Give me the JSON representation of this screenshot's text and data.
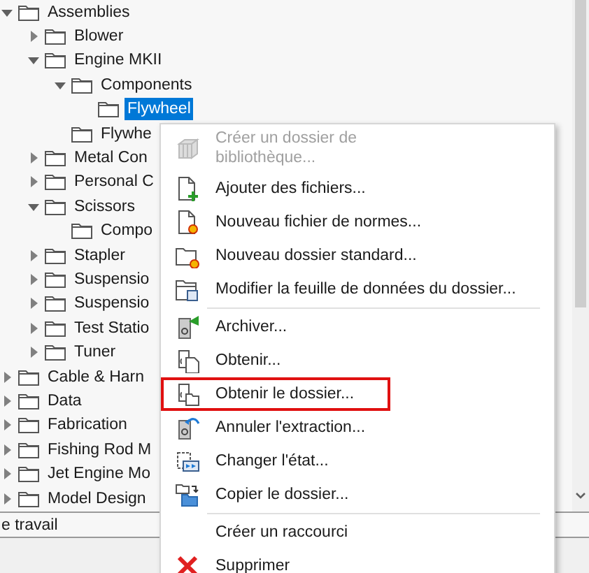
{
  "tree": {
    "items": [
      {
        "label": "Assemblies",
        "expandable": true,
        "expanded": true,
        "selected": false,
        "children": [
          {
            "label": "Blower",
            "expandable": true,
            "expanded": false,
            "selected": false
          },
          {
            "label": "Engine MKII",
            "expandable": true,
            "expanded": true,
            "selected": false,
            "children": [
              {
                "label": "Components",
                "expandable": true,
                "expanded": true,
                "selected": false,
                "children": [
                  {
                    "label": "Flywheel",
                    "expandable": false,
                    "selected": true
                  }
                ]
              },
              {
                "label": "Flywhe",
                "expandable": false,
                "selected": false
              }
            ]
          },
          {
            "label": "Metal Con",
            "expandable": true,
            "expanded": false,
            "selected": false
          },
          {
            "label": "Personal C",
            "expandable": true,
            "expanded": false,
            "selected": false
          },
          {
            "label": "Scissors",
            "expandable": true,
            "expanded": true,
            "selected": false,
            "children": [
              {
                "label": "Compo",
                "expandable": false,
                "selected": false
              }
            ]
          },
          {
            "label": "Stapler",
            "expandable": true,
            "expanded": false,
            "selected": false
          },
          {
            "label": "Suspensio",
            "expandable": true,
            "expanded": false,
            "selected": false
          },
          {
            "label": "Suspensio",
            "expandable": true,
            "expanded": false,
            "selected": false
          },
          {
            "label": "Test Statio",
            "expandable": true,
            "expanded": false,
            "selected": false
          },
          {
            "label": "Tuner",
            "expandable": true,
            "expanded": false,
            "selected": false
          }
        ]
      },
      {
        "label": "Cable & Harn",
        "expandable": true,
        "expanded": false,
        "selected": false
      },
      {
        "label": "Data",
        "expandable": true,
        "expanded": false,
        "selected": false
      },
      {
        "label": "Fabrication",
        "expandable": true,
        "expanded": false,
        "selected": false
      },
      {
        "label": "Fishing Rod M",
        "expandable": true,
        "expanded": false,
        "selected": false
      },
      {
        "label": "Jet Engine Mo",
        "expandable": true,
        "expanded": false,
        "selected": false
      },
      {
        "label": "Model Design",
        "expandable": true,
        "expanded": false,
        "selected": false
      }
    ]
  },
  "status_text": "e travail",
  "context_menu": {
    "items": [
      {
        "kind": "item",
        "label": "Créer un dossier de bibliothèque...",
        "disabled": true,
        "highlighted": false
      },
      {
        "kind": "item",
        "label": "Ajouter des fichiers...",
        "disabled": false,
        "highlighted": false
      },
      {
        "kind": "item",
        "label": "Nouveau fichier de normes...",
        "disabled": false,
        "highlighted": false
      },
      {
        "kind": "item",
        "label": "Nouveau dossier standard...",
        "disabled": false,
        "highlighted": false
      },
      {
        "kind": "item",
        "label": "Modifier la feuille de données du dossier...",
        "disabled": false,
        "highlighted": false
      },
      {
        "kind": "separator"
      },
      {
        "kind": "item",
        "label": "Archiver...",
        "disabled": false,
        "highlighted": false
      },
      {
        "kind": "item",
        "label": "Obtenir...",
        "disabled": false,
        "highlighted": false
      },
      {
        "kind": "item",
        "label": "Obtenir le dossier...",
        "disabled": false,
        "highlighted": true
      },
      {
        "kind": "item",
        "label": "Annuler l'extraction...",
        "disabled": false,
        "highlighted": false
      },
      {
        "kind": "item",
        "label": "Changer l'état...",
        "disabled": false,
        "highlighted": false
      },
      {
        "kind": "item",
        "label": "Copier le dossier...",
        "disabled": false,
        "highlighted": false
      },
      {
        "kind": "separator"
      },
      {
        "kind": "item",
        "label": "Créer un raccourci",
        "disabled": false,
        "highlighted": false
      },
      {
        "kind": "item",
        "label": "Supprimer",
        "disabled": false,
        "highlighted": false
      }
    ]
  }
}
